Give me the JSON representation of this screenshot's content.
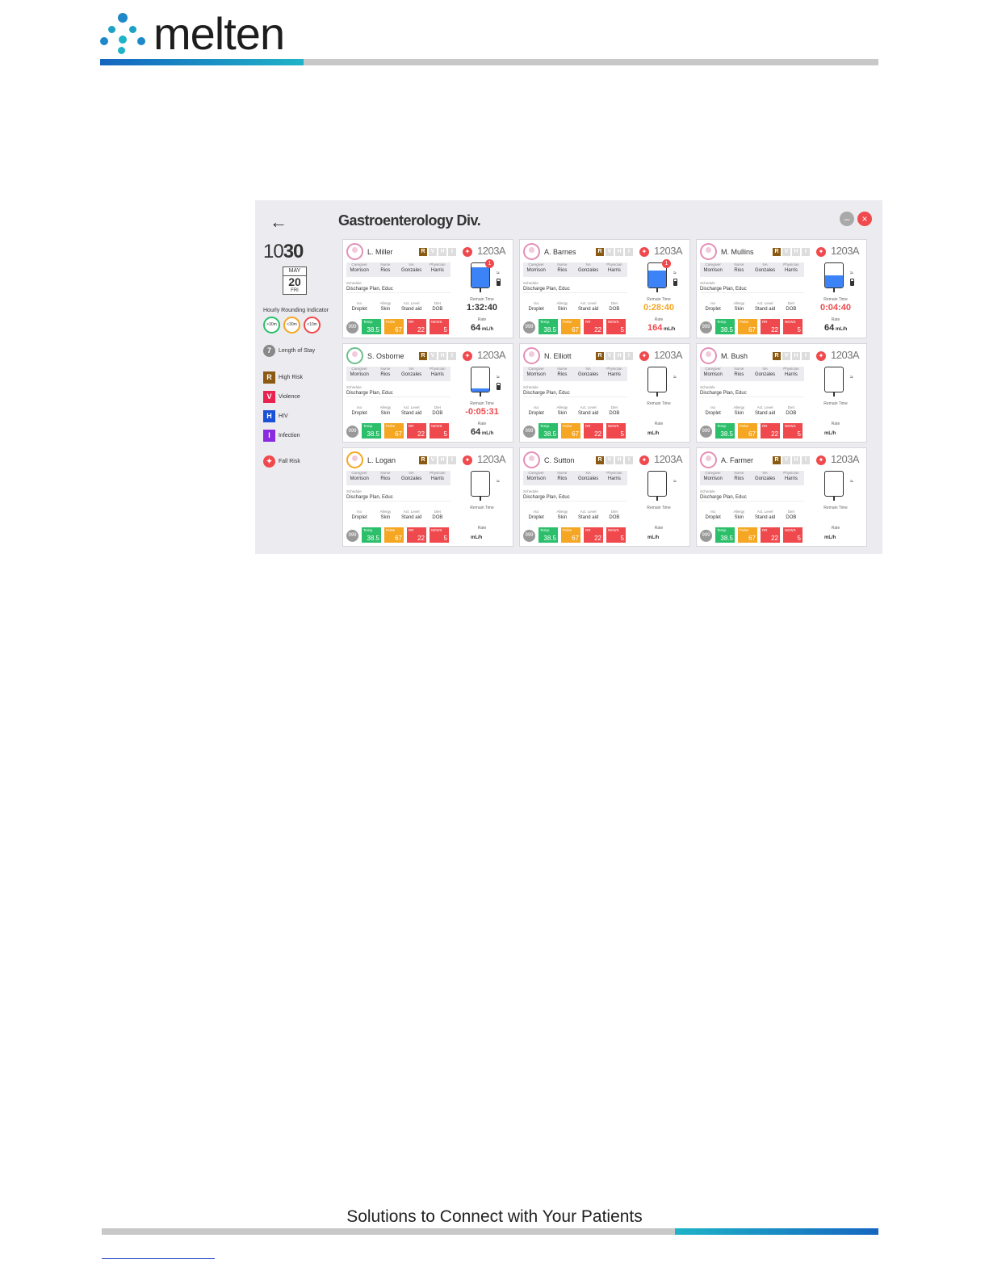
{
  "logo": {
    "text": "melten"
  },
  "header": {
    "title": "Gastroenterology Div."
  },
  "clock": {
    "hour": "10",
    "minute": "30"
  },
  "calendar": {
    "month": "MAY",
    "day": "20",
    "weekday": "FRI"
  },
  "legend": {
    "hri_label": "Hourly Rounding Indicator",
    "rings": [
      ">30m",
      "<30m",
      "<10m"
    ],
    "los_num": "7",
    "los_label": "Length of Stay",
    "items": [
      {
        "letter": "R",
        "label": "High Risk",
        "color": "#8b5a12"
      },
      {
        "letter": "V",
        "label": "Violence",
        "color": "#e8234f"
      },
      {
        "letter": "H",
        "label": "HIV",
        "color": "#1a4fd8"
      },
      {
        "letter": "I",
        "label": "Infection",
        "color": "#8a2be2"
      }
    ],
    "fall_label": "Fall Risk"
  },
  "labels": {
    "caregiver": "Caregiver",
    "nurse": "Nurse",
    "na": "NA",
    "physician": "Physician",
    "schedule": "Schedule",
    "iso": "Iso",
    "allergy": "Allergy",
    "act": "Act. Level",
    "diet": "Diet",
    "temp": "Temp.",
    "pulse": "Pulse",
    "rr": "RR",
    "news": "NEWS",
    "remain": "Remain Time",
    "rate": "Rate",
    "unit": "mL/h"
  },
  "patients": [
    {
      "name": "L. Miller",
      "room": "1203A",
      "remain": "1:32:40",
      "remain_color": "#333",
      "rate": "64",
      "fill": 0.85,
      "alert": "1",
      "battery": true
    },
    {
      "name": "A. Barnes",
      "room": "1203A",
      "remain": "0:28:40",
      "remain_color": "#f5a623",
      "rate": "164",
      "rate_color": "#f0494d",
      "fill": 0.7,
      "alert": "1",
      "battery": true
    },
    {
      "name": "M. Mullins",
      "room": "1203A",
      "remain": "0:04:40",
      "remain_color": "#f0494d",
      "rate": "64",
      "fill": 0.5,
      "alert": "",
      "battery": true
    },
    {
      "name": "S. Osborne",
      "room": "1203A",
      "remain": "-0:05:31",
      "remain_color": "#f0494d",
      "rate": "64",
      "fill": 0.15,
      "alert": "",
      "battery": true
    },
    {
      "name": "N. Elliott",
      "room": "1203A",
      "remain": "",
      "rate": "",
      "fill": 0,
      "alert": "",
      "battery": false
    },
    {
      "name": "M. Bush",
      "room": "1203A",
      "remain": "",
      "rate": "",
      "fill": 0,
      "alert": "",
      "battery": false
    },
    {
      "name": "L. Logan",
      "room": "1203A",
      "remain": "",
      "rate": "",
      "fill": 0,
      "alert": "",
      "battery": false
    },
    {
      "name": "C. Sutton",
      "room": "1203A",
      "remain": "",
      "rate": "",
      "fill": 0,
      "alert": "",
      "battery": false
    },
    {
      "name": "A. Farmer",
      "room": "1203A",
      "remain": "",
      "rate": "",
      "fill": 0,
      "alert": "",
      "battery": false
    }
  ],
  "common": {
    "caregiver": "Morrison",
    "nurse": "Rios",
    "na": "Gonzales",
    "physician": "Harris",
    "schedule": "Discharge Plan, Educ",
    "iso": "Droplet",
    "allergy": "Skin",
    "act": "Stand aid",
    "diet": "DOB",
    "los": "999",
    "temp": "38.5",
    "pulse": "67",
    "rr": "22",
    "news": "5"
  },
  "colors": {
    "green": "#2bbf6a",
    "orange": "#f5a623",
    "red": "#f0494d"
  },
  "footer": {
    "tagline": "Solutions to Connect with Your Patients"
  }
}
